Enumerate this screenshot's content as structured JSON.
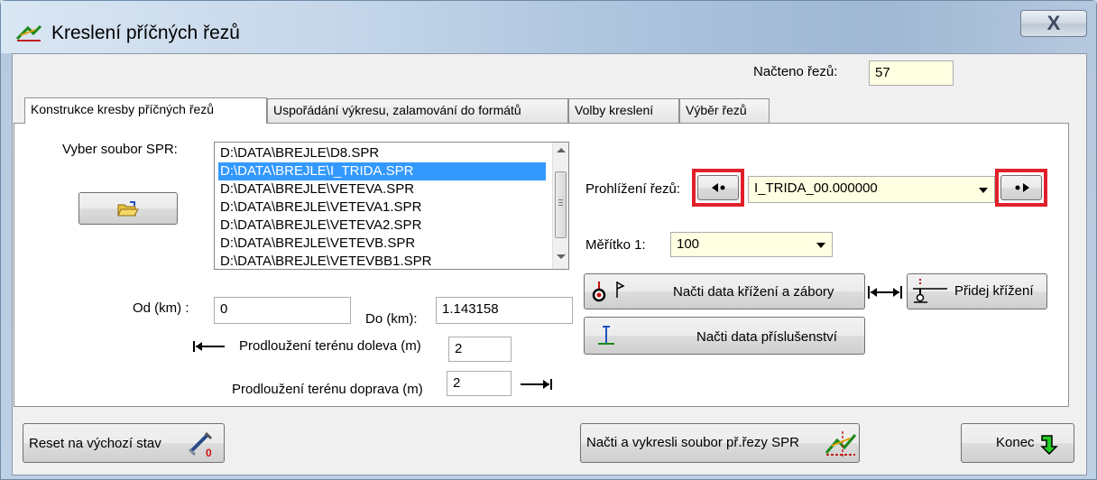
{
  "window": {
    "title": "Kreslení příčných řezů",
    "close_glyph": "X"
  },
  "header": {
    "loaded_label": "Načteno řezů:",
    "loaded_value": "57"
  },
  "tabs": [
    {
      "label": "Konstrukce kresby příčných řezů",
      "active": true
    },
    {
      "label": "Uspořádání výkresu, zalamování do formátů",
      "active": false
    },
    {
      "label": "Volby kreslení",
      "active": false
    },
    {
      "label": "Výběr řezů",
      "active": false
    }
  ],
  "spr": {
    "label": "Vyber soubor SPR:",
    "files": [
      "D:\\DATA\\BREJLE\\D8.SPR",
      "D:\\DATA\\BREJLE\\I_TRIDA.SPR",
      "D:\\DATA\\BREJLE\\VETEVA.SPR",
      "D:\\DATA\\BREJLE\\VETEVA1.SPR",
      "D:\\DATA\\BREJLE\\VETEVA2.SPR",
      "D:\\DATA\\BREJLE\\VETEVB.SPR",
      "D:\\DATA\\BREJLE\\VETEVBB1.SPR"
    ],
    "selected_index": 1
  },
  "range": {
    "from_label": "Od (km) :",
    "from_value": "0",
    "to_label": "Do (km):",
    "to_value": "1.143158"
  },
  "terrain": {
    "left_label": "Prodloužení terénu doleva (m)",
    "left_value": "2",
    "right_label": "Prodloužení terénu doprava (m)",
    "right_value": "2"
  },
  "browse": {
    "label": "Prohlížení řezů:",
    "current": "I_TRIDA_00.000000"
  },
  "scale": {
    "label": "Měřítko 1:",
    "value": "100"
  },
  "actions": {
    "load_crossing": "Načti data křížení a zábory",
    "add_crossing": "Přidej křížení",
    "load_accessories": "Načti data příslušenství"
  },
  "footer": {
    "reset": "Reset na výchozí stav",
    "load_draw": "Načti a vykresli soubor př.řezy SPR",
    "end": "Konec"
  },
  "colors": {
    "highlight": "#e0202a",
    "selection": "#3399ff",
    "field_yellow": "#ffffe1"
  }
}
